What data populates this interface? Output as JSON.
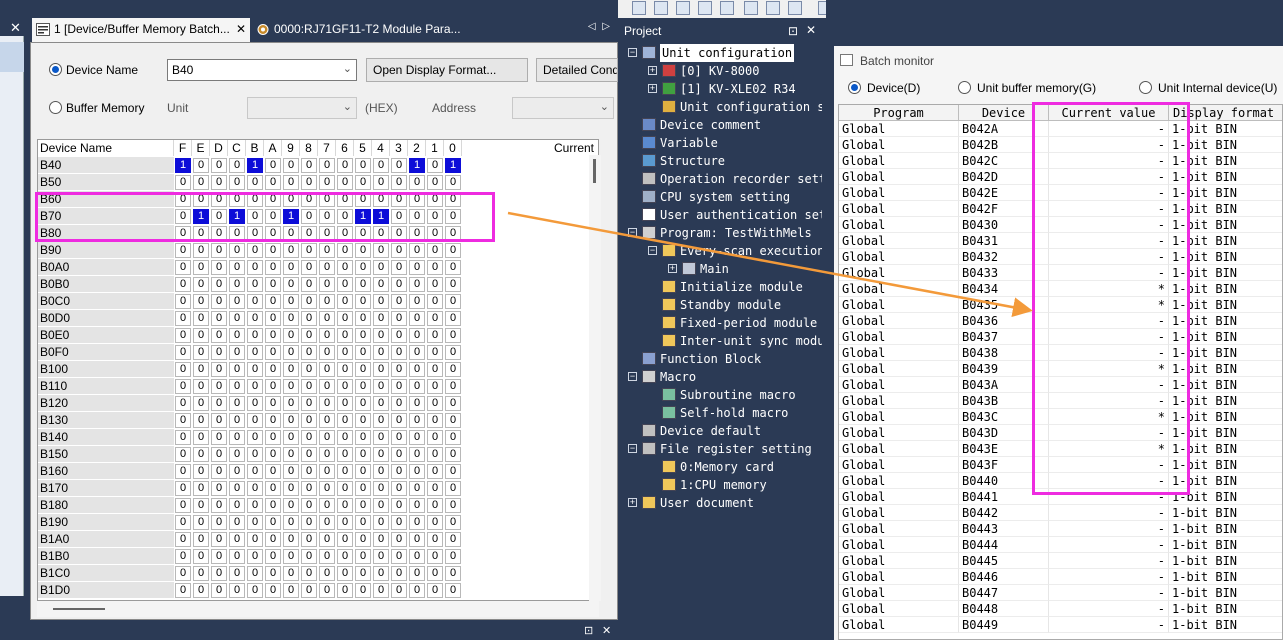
{
  "left_window": {
    "tabs": [
      {
        "label": "1 [Device/Buffer Memory Batch...",
        "active": true
      },
      {
        "label": "0000:RJ71GF11-T2 Module Para...",
        "active": false
      }
    ],
    "tab_close": "✕",
    "tab_nav": "◁ ▷",
    "device_name_radio_label": "Device Name",
    "device_name_value": "B40",
    "open_display_format_button": "Open Display Format...",
    "detailed_conditions_button": "Detailed Condi",
    "buffer_memory_radio_label": "Buffer Memory",
    "unit_label": "Unit",
    "hex_label": "(HEX)",
    "address_label": "Address",
    "grid_header_device": "Device Name",
    "grid_header_current": "Current",
    "bit_headers": [
      "F",
      "E",
      "D",
      "C",
      "B",
      "A",
      "9",
      "8",
      "7",
      "6",
      "5",
      "4",
      "3",
      "2",
      "1",
      "0"
    ],
    "rows": [
      {
        "name": "B40",
        "bits": "1000100000000101"
      },
      {
        "name": "B50",
        "bits": "0000000000000000"
      },
      {
        "name": "B60",
        "bits": "0000000000000000"
      },
      {
        "name": "B70",
        "bits": "0101001000110000"
      },
      {
        "name": "B80",
        "bits": "0000000000000000"
      },
      {
        "name": "B90",
        "bits": "0000000000000000"
      },
      {
        "name": "B0A0",
        "bits": "0000000000000000"
      },
      {
        "name": "B0B0",
        "bits": "0000000000000000"
      },
      {
        "name": "B0C0",
        "bits": "0000000000000000"
      },
      {
        "name": "B0D0",
        "bits": "0000000000000000"
      },
      {
        "name": "B0E0",
        "bits": "0000000000000000"
      },
      {
        "name": "B0F0",
        "bits": "0000000000000000"
      },
      {
        "name": "B100",
        "bits": "0000000000000000"
      },
      {
        "name": "B110",
        "bits": "0000000000000000"
      },
      {
        "name": "B120",
        "bits": "0000000000000000"
      },
      {
        "name": "B130",
        "bits": "0000000000000000"
      },
      {
        "name": "B140",
        "bits": "0000000000000000"
      },
      {
        "name": "B150",
        "bits": "0000000000000000"
      },
      {
        "name": "B160",
        "bits": "0000000000000000"
      },
      {
        "name": "B170",
        "bits": "0000000000000000"
      },
      {
        "name": "B180",
        "bits": "0000000000000000"
      },
      {
        "name": "B190",
        "bits": "0000000000000000"
      },
      {
        "name": "B1A0",
        "bits": "0000000000000000"
      },
      {
        "name": "B1B0",
        "bits": "0000000000000000"
      },
      {
        "name": "B1C0",
        "bits": "0000000000000000"
      },
      {
        "name": "B1D0",
        "bits": "0000000000000000"
      }
    ],
    "bottom_pin": "⊡",
    "bottom_close": "✕"
  },
  "project": {
    "title": "Project",
    "pin": "⊡",
    "close": "✕",
    "nodes": [
      {
        "text": "Unit configuration",
        "level": 0,
        "exp": "−",
        "icon": "unit-config-icon",
        "selected": true
      },
      {
        "text": "[0]  KV-8000",
        "level": 1,
        "exp": "+",
        "icon": "cpu-unit-icon"
      },
      {
        "text": "[1]  KV-XLE02   R34",
        "level": 1,
        "exp": "+",
        "icon": "ethernet-unit-icon"
      },
      {
        "text": "Unit configuration s",
        "level": 1,
        "exp": "",
        "icon": "settings-icon"
      },
      {
        "text": "Device comment",
        "level": 0,
        "exp": "",
        "icon": "comment-icon"
      },
      {
        "text": "Variable",
        "level": 0,
        "exp": "",
        "icon": "variable-icon"
      },
      {
        "text": "Structure",
        "level": 0,
        "exp": "",
        "icon": "structure-icon"
      },
      {
        "text": "Operation recorder sett",
        "level": 0,
        "exp": "",
        "icon": "recorder-icon"
      },
      {
        "text": "CPU system setting",
        "level": 0,
        "exp": "",
        "icon": "cpu-setting-icon"
      },
      {
        "text": "User authentication set",
        "level": 0,
        "exp": "",
        "icon": "user-icon"
      },
      {
        "text": "Program: TestWithMels",
        "level": 0,
        "exp": "−",
        "icon": "program-icon"
      },
      {
        "text": "Every-scan execution",
        "level": 1,
        "exp": "−",
        "icon": "folder-icon"
      },
      {
        "text": "Main",
        "level": 2,
        "exp": "+",
        "icon": "ladder-icon"
      },
      {
        "text": "Initialize module",
        "level": 1,
        "exp": "",
        "icon": "folder-icon"
      },
      {
        "text": "Standby module",
        "level": 1,
        "exp": "",
        "icon": "folder-icon"
      },
      {
        "text": "Fixed-period module",
        "level": 1,
        "exp": "",
        "icon": "folder-icon"
      },
      {
        "text": "Inter-unit sync modu",
        "level": 1,
        "exp": "",
        "icon": "folder-icon"
      },
      {
        "text": "Function Block",
        "level": 0,
        "exp": "",
        "icon": "function-block-icon"
      },
      {
        "text": "Macro",
        "level": 0,
        "exp": "−",
        "icon": "macro-icon"
      },
      {
        "text": "Subroutine macro",
        "level": 1,
        "exp": "",
        "icon": "subroutine-icon"
      },
      {
        "text": "Self-hold macro",
        "level": 1,
        "exp": "",
        "icon": "selfhold-icon"
      },
      {
        "text": "Device default",
        "level": 0,
        "exp": "",
        "icon": "device-default-icon"
      },
      {
        "text": "File register setting",
        "level": 0,
        "exp": "−",
        "icon": "file-register-icon"
      },
      {
        "text": "0:Memory card",
        "level": 1,
        "exp": "",
        "icon": "folder-icon"
      },
      {
        "text": "1:CPU memory",
        "level": 1,
        "exp": "",
        "icon": "folder-icon"
      },
      {
        "text": "User document",
        "level": 0,
        "exp": "+",
        "icon": "document-icon"
      }
    ]
  },
  "batch_monitor": {
    "title": "Batch monitor",
    "radios": [
      {
        "label": "Device(D)",
        "on": true
      },
      {
        "label": "Unit buffer memory(G)",
        "on": false
      },
      {
        "label": "Unit Internal device(U)",
        "on": false
      }
    ],
    "headers": [
      "Program",
      "Device",
      "Current value",
      "Display format"
    ],
    "rows": [
      {
        "program": "Global",
        "device": "B042A",
        "current": "-",
        "format": "1-bit BIN"
      },
      {
        "program": "Global",
        "device": "B042B",
        "current": "-",
        "format": "1-bit BIN"
      },
      {
        "program": "Global",
        "device": "B042C",
        "current": "-",
        "format": "1-bit BIN"
      },
      {
        "program": "Global",
        "device": "B042D",
        "current": "-",
        "format": "1-bit BIN"
      },
      {
        "program": "Global",
        "device": "B042E",
        "current": "-",
        "format": "1-bit BIN"
      },
      {
        "program": "Global",
        "device": "B042F",
        "current": "-",
        "format": "1-bit BIN"
      },
      {
        "program": "Global",
        "device": "B0430",
        "current": "-",
        "format": "1-bit BIN"
      },
      {
        "program": "Global",
        "device": "B0431",
        "current": "-",
        "format": "1-bit BIN"
      },
      {
        "program": "Global",
        "device": "B0432",
        "current": "-",
        "format": "1-bit BIN"
      },
      {
        "program": "Global",
        "device": "B0433",
        "current": "-",
        "format": "1-bit BIN"
      },
      {
        "program": "Global",
        "device": "B0434",
        "current": "*",
        "format": "1-bit BIN"
      },
      {
        "program": "Global",
        "device": "B0435",
        "current": "*",
        "format": "1-bit BIN"
      },
      {
        "program": "Global",
        "device": "B0436",
        "current": "-",
        "format": "1-bit BIN"
      },
      {
        "program": "Global",
        "device": "B0437",
        "current": "-",
        "format": "1-bit BIN"
      },
      {
        "program": "Global",
        "device": "B0438",
        "current": "-",
        "format": "1-bit BIN"
      },
      {
        "program": "Global",
        "device": "B0439",
        "current": "*",
        "format": "1-bit BIN"
      },
      {
        "program": "Global",
        "device": "B043A",
        "current": "-",
        "format": "1-bit BIN"
      },
      {
        "program": "Global",
        "device": "B043B",
        "current": "-",
        "format": "1-bit BIN"
      },
      {
        "program": "Global",
        "device": "B043C",
        "current": "*",
        "format": "1-bit BIN"
      },
      {
        "program": "Global",
        "device": "B043D",
        "current": "-",
        "format": "1-bit BIN"
      },
      {
        "program": "Global",
        "device": "B043E",
        "current": "*",
        "format": "1-bit BIN"
      },
      {
        "program": "Global",
        "device": "B043F",
        "current": "-",
        "format": "1-bit BIN"
      },
      {
        "program": "Global",
        "device": "B0440",
        "current": "-",
        "format": "1-bit BIN"
      },
      {
        "program": "Global",
        "device": "B0441",
        "current": "-",
        "format": "1-bit BIN"
      },
      {
        "program": "Global",
        "device": "B0442",
        "current": "-",
        "format": "1-bit BIN"
      },
      {
        "program": "Global",
        "device": "B0443",
        "current": "-",
        "format": "1-bit BIN"
      },
      {
        "program": "Global",
        "device": "B0444",
        "current": "-",
        "format": "1-bit BIN"
      },
      {
        "program": "Global",
        "device": "B0445",
        "current": "-",
        "format": "1-bit BIN"
      },
      {
        "program": "Global",
        "device": "B0446",
        "current": "-",
        "format": "1-bit BIN"
      },
      {
        "program": "Global",
        "device": "B0447",
        "current": "-",
        "format": "1-bit BIN"
      },
      {
        "program": "Global",
        "device": "B0448",
        "current": "-",
        "format": "1-bit BIN"
      },
      {
        "program": "Global",
        "device": "B0449",
        "current": "-",
        "format": "1-bit BIN"
      }
    ]
  },
  "colors": {
    "dark_bg": "#2b3a55",
    "bit_on": "#0d0dd8",
    "highlight": "#ee2be0",
    "arrow": "#f39a3a"
  }
}
